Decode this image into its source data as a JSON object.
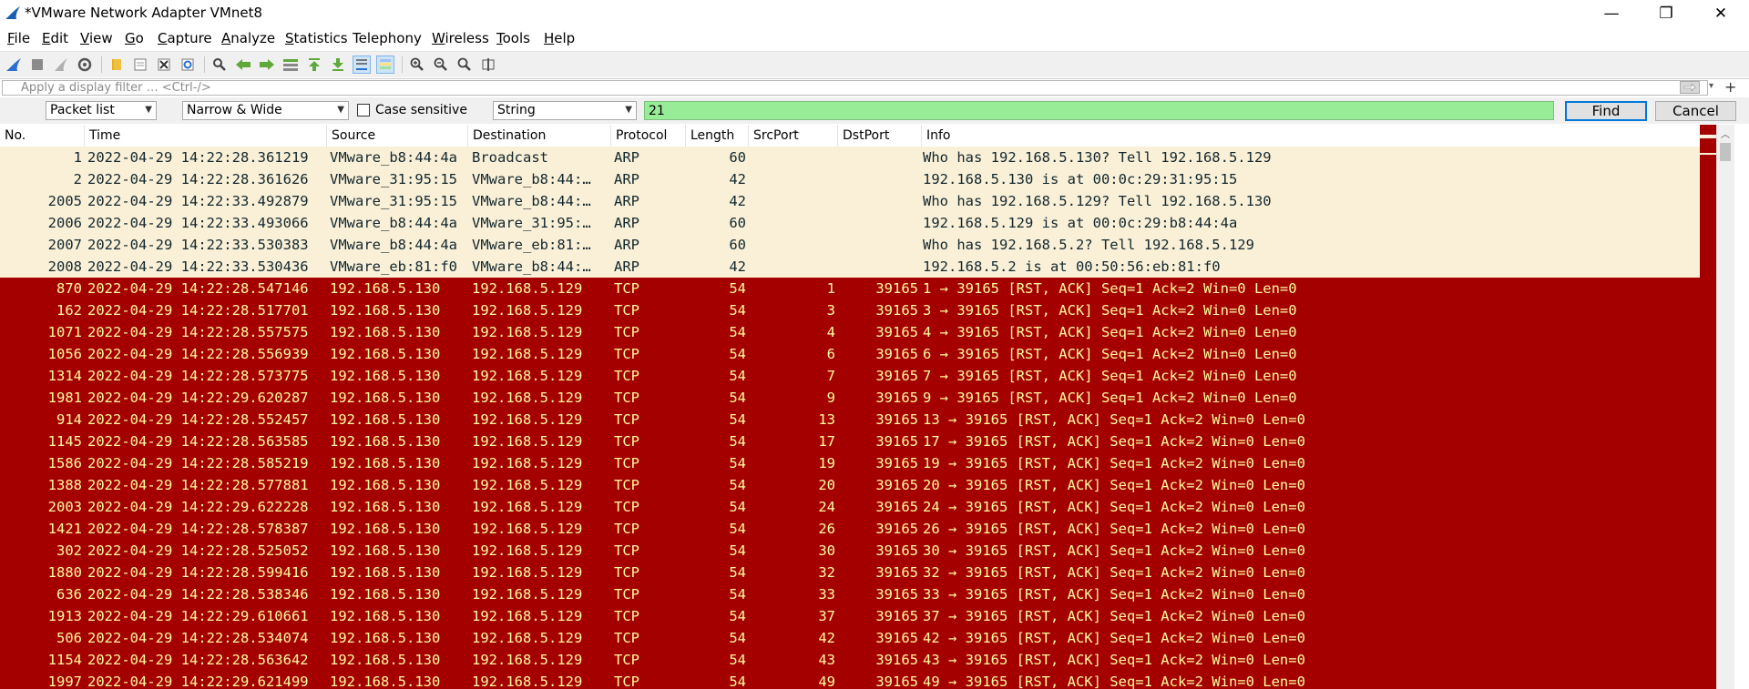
{
  "window": {
    "title": "*VMware Network Adapter VMnet8",
    "minimize": "—",
    "restore": "❐",
    "close": "✕"
  },
  "menu": [
    {
      "label": "File",
      "u": "F",
      "rest": "ile"
    },
    {
      "label": "Edit",
      "u": "E",
      "rest": "dit"
    },
    {
      "label": "View",
      "u": "V",
      "rest": "iew"
    },
    {
      "label": "Go",
      "u": "G",
      "rest": "o"
    },
    {
      "label": "Capture",
      "u": "C",
      "rest": "apture"
    },
    {
      "label": "Analyze",
      "u": "A",
      "rest": "nalyze"
    },
    {
      "label": "Statistics",
      "u": "S",
      "rest": "tatistics"
    },
    {
      "label": "Telephony",
      "u": "",
      "rest": "Telephony"
    },
    {
      "label": "Wireless",
      "u": "W",
      "rest": "ireless"
    },
    {
      "label": "Tools",
      "u": "T",
      "rest": "ools"
    },
    {
      "label": "Help",
      "u": "H",
      "rest": "elp"
    }
  ],
  "filter": {
    "placeholder": "Apply a display filter … <Ctrl-/>",
    "plus": "+"
  },
  "find": {
    "search_in": "Packet list",
    "char_width": "Narrow & Wide",
    "case_sensitive_label": "Case sensitive",
    "search_type": "String",
    "value": "21",
    "find_label": "Find",
    "cancel_label": "Cancel"
  },
  "columns": [
    "No.",
    "Time",
    "Source",
    "Destination",
    "Protocol",
    "Length",
    "SrcPort",
    "DstPort",
    "Info"
  ],
  "colors": {
    "arp_bg": "#faf0d7",
    "arp_fg": "#12272e",
    "tcp_bg": "#a40000",
    "tcp_fg": "#fffc9c",
    "find_bg": "#98ec98"
  },
  "packets": [
    {
      "no": "1",
      "time": "2022-04-29 14:22:28.361219",
      "src": "VMware_b8:44:4a",
      "dst": "Broadcast",
      "proto": "ARP",
      "len": "60",
      "sport": "",
      "dport": "",
      "info": "Who has 192.168.5.130? Tell 192.168.5.129",
      "kind": "arp"
    },
    {
      "no": "2",
      "time": "2022-04-29 14:22:28.361626",
      "src": "VMware_31:95:15",
      "dst": "VMware_b8:44:…",
      "proto": "ARP",
      "len": "42",
      "sport": "",
      "dport": "",
      "info": "192.168.5.130 is at 00:0c:29:31:95:15",
      "kind": "arp"
    },
    {
      "no": "2005",
      "time": "2022-04-29 14:22:33.492879",
      "src": "VMware_31:95:15",
      "dst": "VMware_b8:44:…",
      "proto": "ARP",
      "len": "42",
      "sport": "",
      "dport": "",
      "info": "Who has 192.168.5.129? Tell 192.168.5.130",
      "kind": "arp"
    },
    {
      "no": "2006",
      "time": "2022-04-29 14:22:33.493066",
      "src": "VMware_b8:44:4a",
      "dst": "VMware_31:95:…",
      "proto": "ARP",
      "len": "60",
      "sport": "",
      "dport": "",
      "info": "192.168.5.129 is at 00:0c:29:b8:44:4a",
      "kind": "arp"
    },
    {
      "no": "2007",
      "time": "2022-04-29 14:22:33.530383",
      "src": "VMware_b8:44:4a",
      "dst": "VMware_eb:81:…",
      "proto": "ARP",
      "len": "60",
      "sport": "",
      "dport": "",
      "info": "Who has 192.168.5.2? Tell 192.168.5.129",
      "kind": "arp"
    },
    {
      "no": "2008",
      "time": "2022-04-29 14:22:33.530436",
      "src": "VMware_eb:81:f0",
      "dst": "VMware_b8:44:…",
      "proto": "ARP",
      "len": "42",
      "sport": "",
      "dport": "",
      "info": "192.168.5.2 is at 00:50:56:eb:81:f0",
      "kind": "arp"
    },
    {
      "no": "870",
      "time": "2022-04-29 14:22:28.547146",
      "src": "192.168.5.130",
      "dst": "192.168.5.129",
      "proto": "TCP",
      "len": "54",
      "sport": "1",
      "dport": "39165",
      "info": "1 → 39165 [RST, ACK] Seq=1 Ack=2 Win=0 Len=0",
      "kind": "tcp"
    },
    {
      "no": "162",
      "time": "2022-04-29 14:22:28.517701",
      "src": "192.168.5.130",
      "dst": "192.168.5.129",
      "proto": "TCP",
      "len": "54",
      "sport": "3",
      "dport": "39165",
      "info": "3 → 39165 [RST, ACK] Seq=1 Ack=2 Win=0 Len=0",
      "kind": "tcp"
    },
    {
      "no": "1071",
      "time": "2022-04-29 14:22:28.557575",
      "src": "192.168.5.130",
      "dst": "192.168.5.129",
      "proto": "TCP",
      "len": "54",
      "sport": "4",
      "dport": "39165",
      "info": "4 → 39165 [RST, ACK] Seq=1 Ack=2 Win=0 Len=0",
      "kind": "tcp"
    },
    {
      "no": "1056",
      "time": "2022-04-29 14:22:28.556939",
      "src": "192.168.5.130",
      "dst": "192.168.5.129",
      "proto": "TCP",
      "len": "54",
      "sport": "6",
      "dport": "39165",
      "info": "6 → 39165 [RST, ACK] Seq=1 Ack=2 Win=0 Len=0",
      "kind": "tcp"
    },
    {
      "no": "1314",
      "time": "2022-04-29 14:22:28.573775",
      "src": "192.168.5.130",
      "dst": "192.168.5.129",
      "proto": "TCP",
      "len": "54",
      "sport": "7",
      "dport": "39165",
      "info": "7 → 39165 [RST, ACK] Seq=1 Ack=2 Win=0 Len=0",
      "kind": "tcp"
    },
    {
      "no": "1981",
      "time": "2022-04-29 14:22:29.620287",
      "src": "192.168.5.130",
      "dst": "192.168.5.129",
      "proto": "TCP",
      "len": "54",
      "sport": "9",
      "dport": "39165",
      "info": "9 → 39165 [RST, ACK] Seq=1 Ack=2 Win=0 Len=0",
      "kind": "tcp"
    },
    {
      "no": "914",
      "time": "2022-04-29 14:22:28.552457",
      "src": "192.168.5.130",
      "dst": "192.168.5.129",
      "proto": "TCP",
      "len": "54",
      "sport": "13",
      "dport": "39165",
      "info": "13 → 39165 [RST, ACK] Seq=1 Ack=2 Win=0 Len=0",
      "kind": "tcp"
    },
    {
      "no": "1145",
      "time": "2022-04-29 14:22:28.563585",
      "src": "192.168.5.130",
      "dst": "192.168.5.129",
      "proto": "TCP",
      "len": "54",
      "sport": "17",
      "dport": "39165",
      "info": "17 → 39165 [RST, ACK] Seq=1 Ack=2 Win=0 Len=0",
      "kind": "tcp"
    },
    {
      "no": "1586",
      "time": "2022-04-29 14:22:28.585219",
      "src": "192.168.5.130",
      "dst": "192.168.5.129",
      "proto": "TCP",
      "len": "54",
      "sport": "19",
      "dport": "39165",
      "info": "19 → 39165 [RST, ACK] Seq=1 Ack=2 Win=0 Len=0",
      "kind": "tcp"
    },
    {
      "no": "1388",
      "time": "2022-04-29 14:22:28.577881",
      "src": "192.168.5.130",
      "dst": "192.168.5.129",
      "proto": "TCP",
      "len": "54",
      "sport": "20",
      "dport": "39165",
      "info": "20 → 39165 [RST, ACK] Seq=1 Ack=2 Win=0 Len=0",
      "kind": "tcp"
    },
    {
      "no": "2003",
      "time": "2022-04-29 14:22:29.622228",
      "src": "192.168.5.130",
      "dst": "192.168.5.129",
      "proto": "TCP",
      "len": "54",
      "sport": "24",
      "dport": "39165",
      "info": "24 → 39165 [RST, ACK] Seq=1 Ack=2 Win=0 Len=0",
      "kind": "tcp"
    },
    {
      "no": "1421",
      "time": "2022-04-29 14:22:28.578387",
      "src": "192.168.5.130",
      "dst": "192.168.5.129",
      "proto": "TCP",
      "len": "54",
      "sport": "26",
      "dport": "39165",
      "info": "26 → 39165 [RST, ACK] Seq=1 Ack=2 Win=0 Len=0",
      "kind": "tcp"
    },
    {
      "no": "302",
      "time": "2022-04-29 14:22:28.525052",
      "src": "192.168.5.130",
      "dst": "192.168.5.129",
      "proto": "TCP",
      "len": "54",
      "sport": "30",
      "dport": "39165",
      "info": "30 → 39165 [RST, ACK] Seq=1 Ack=2 Win=0 Len=0",
      "kind": "tcp"
    },
    {
      "no": "1880",
      "time": "2022-04-29 14:22:28.599416",
      "src": "192.168.5.130",
      "dst": "192.168.5.129",
      "proto": "TCP",
      "len": "54",
      "sport": "32",
      "dport": "39165",
      "info": "32 → 39165 [RST, ACK] Seq=1 Ack=2 Win=0 Len=0",
      "kind": "tcp"
    },
    {
      "no": "636",
      "time": "2022-04-29 14:22:28.538346",
      "src": "192.168.5.130",
      "dst": "192.168.5.129",
      "proto": "TCP",
      "len": "54",
      "sport": "33",
      "dport": "39165",
      "info": "33 → 39165 [RST, ACK] Seq=1 Ack=2 Win=0 Len=0",
      "kind": "tcp"
    },
    {
      "no": "1913",
      "time": "2022-04-29 14:22:29.610661",
      "src": "192.168.5.130",
      "dst": "192.168.5.129",
      "proto": "TCP",
      "len": "54",
      "sport": "37",
      "dport": "39165",
      "info": "37 → 39165 [RST, ACK] Seq=1 Ack=2 Win=0 Len=0",
      "kind": "tcp"
    },
    {
      "no": "506",
      "time": "2022-04-29 14:22:28.534074",
      "src": "192.168.5.130",
      "dst": "192.168.5.129",
      "proto": "TCP",
      "len": "54",
      "sport": "42",
      "dport": "39165",
      "info": "42 → 39165 [RST, ACK] Seq=1 Ack=2 Win=0 Len=0",
      "kind": "tcp"
    },
    {
      "no": "1154",
      "time": "2022-04-29 14:22:28.563642",
      "src": "192.168.5.130",
      "dst": "192.168.5.129",
      "proto": "TCP",
      "len": "54",
      "sport": "43",
      "dport": "39165",
      "info": "43 → 39165 [RST, ACK] Seq=1 Ack=2 Win=0 Len=0",
      "kind": "tcp"
    },
    {
      "no": "1997",
      "time": "2022-04-29 14:22:29.621499",
      "src": "192.168.5.130",
      "dst": "192.168.5.129",
      "proto": "TCP",
      "len": "54",
      "sport": "49",
      "dport": "39165",
      "info": "49 → 39165 [RST, ACK] Seq=1 Ack=2 Win=0 Len=0",
      "kind": "tcp"
    }
  ]
}
